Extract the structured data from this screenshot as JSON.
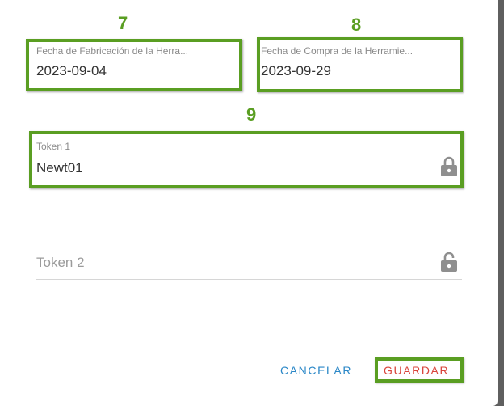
{
  "markers": {
    "fab": "7",
    "compra": "8",
    "token1": "9"
  },
  "fields": {
    "fecha_fabricacion": {
      "label": "Fecha de Fabricación de la Herra...",
      "value": "2023-09-04"
    },
    "fecha_compra": {
      "label": "Fecha de Compra de la Herramie...",
      "value": "2023-09-29"
    },
    "token1": {
      "label": "Token 1",
      "value": "Newt01"
    },
    "token2": {
      "placeholder": "Token 2",
      "value": ""
    }
  },
  "actions": {
    "cancel_label": "CANCELAR",
    "save_label": "GUARDAR"
  },
  "colors": {
    "highlight": "#5a9e22",
    "cancel": "#2a87c7",
    "save": "#d9443a",
    "lock": "#8f8f8f"
  },
  "icons": {
    "lock_locked": "lock-icon",
    "lock_open": "lock-open-icon"
  }
}
